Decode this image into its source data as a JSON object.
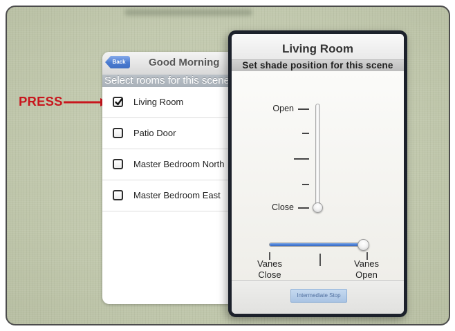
{
  "colors": {
    "annotation_red": "#c8161d",
    "slider_blue": "#4a7fd6",
    "back_button_blue": "#4a7bd0",
    "background_sage": "#c3cab0"
  },
  "icons": {
    "annotation_arrow": "arrow-right-icon",
    "checkbox_checked": "checkmark-icon",
    "back_button": "chevron-left-icon"
  },
  "annotation": {
    "label": "PRESS"
  },
  "scene_panel": {
    "back_label": "Back",
    "title": "Good Morning",
    "subheader": "Select rooms for this scene",
    "rooms": [
      {
        "label": "Living Room",
        "checked": true
      },
      {
        "label": "Patio Door",
        "checked": false
      },
      {
        "label": "Master Bedroom North",
        "checked": false
      },
      {
        "label": "Master Bedroom East",
        "checked": false
      }
    ]
  },
  "shade_dialog": {
    "title": "Living Room",
    "subheader": "Set shade position for this scene",
    "shade_position": {
      "open_label": "Open",
      "close_label": "Close",
      "open_fraction": 0
    },
    "vanes": {
      "close_label": [
        "Vanes",
        "Close"
      ],
      "open_label": [
        "Vanes",
        "Open"
      ],
      "open_fraction": 1
    },
    "intermediate_stop_label": "Intermediate Stop"
  }
}
